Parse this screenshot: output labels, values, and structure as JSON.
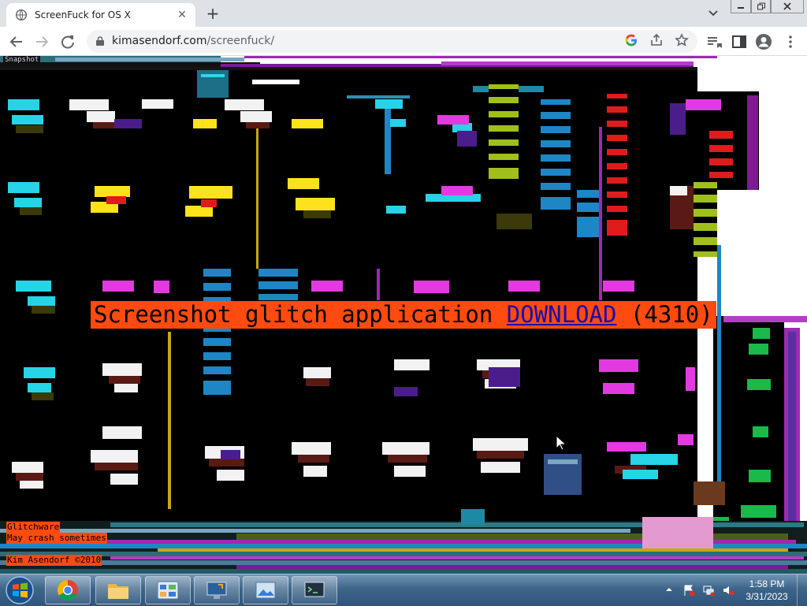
{
  "browser": {
    "tab_title": "ScreenFuck for OS X",
    "url_host": "kimasendorf.com",
    "url_path": "/screenfuck/"
  },
  "page": {
    "snapshot_label": "Snapshot",
    "headline_text": "Screenshot glitch application ",
    "download_link": "DOWNLOAD",
    "download_count": " (4310)",
    "notice_line1": "Glitchware",
    "notice_line2": "May crash sometimes",
    "credit": "Kim Asendorf ©2010"
  },
  "taskbar": {
    "time": "1:58 PM",
    "date": "3/31/2023",
    "pinned": [
      "chrome-icon",
      "file-explorer-icon",
      "control-panel-icon",
      "remote-desktop-icon",
      "photo-viewer-icon",
      "terminal-icon"
    ]
  },
  "colors": {
    "highlight": "#ff4a10",
    "glitch_background": "#000000",
    "taskbar": "#3d6489"
  }
}
